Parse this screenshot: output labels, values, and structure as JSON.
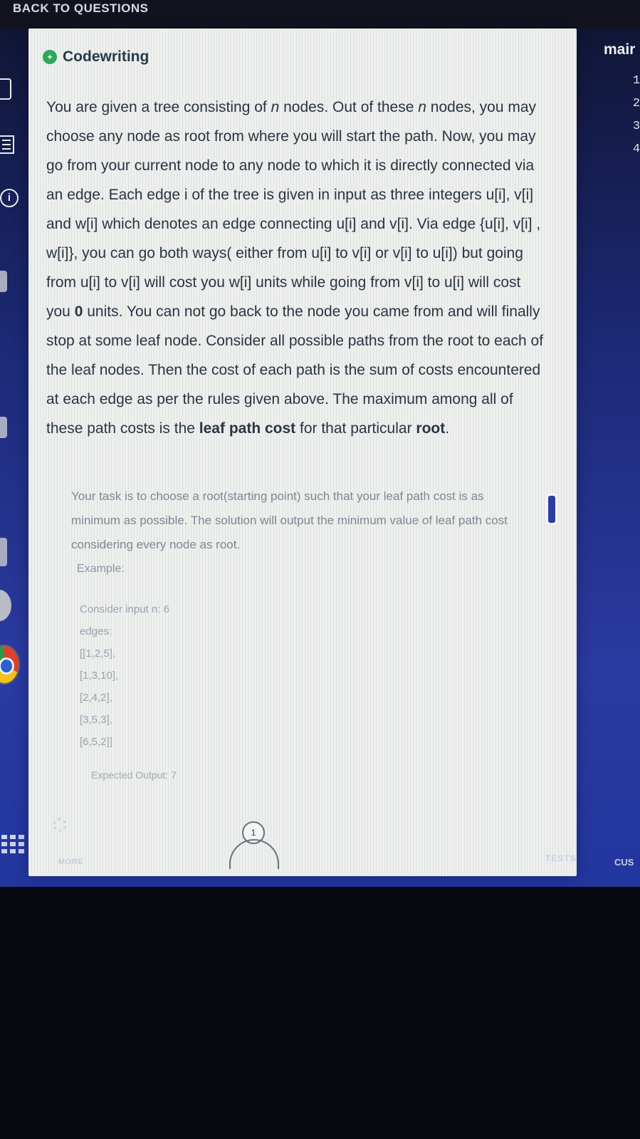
{
  "topbar": {
    "back_label": "BACK TO QUESTIONS"
  },
  "problem": {
    "badge_icon": "codewriting-icon",
    "title": "Codewriting",
    "paragraph_html": "You are given a tree consisting of <i>n</i> nodes. Out of these <i>n</i> nodes, you may choose any node as root from where you will start the path. Now, you may go from your current node to any node to which it is directly connected via an edge. Each edge i of the tree is given in input as three integers u[i], v[i] and w[i] which denotes an edge connecting u[i] and v[i]. Via edge {u[i], v[i] , w[i]}, you can go both ways( either from u[i] to v[i] or v[i] to u[i]) but going from u[i] to v[i] will cost you w[i] units while going from v[i] to u[i] will cost you <b>0</b> units. You can not go back to the node you came from and will finally stop at some leaf node. Consider all possible paths from the root to each of the leaf nodes. Then the cost of each path is the sum of costs encountered at each edge as per the rules given above. The maximum among all of these path costs is the <b>leaf path cost</b> for that particular <b>root</b>.",
    "task": "Your task is to choose a root(starting point) such that your leaf path cost is as minimum as possible. The solution will output the minimum value of leaf path cost considering every node as root.",
    "example_label": "Example:",
    "example_lines": [
      "Consider input n: 6",
      "edges:",
      "[[1,2,5],",
      "[1,3,10],",
      "[2,4,2],",
      "[3,5,3],",
      "[6,5,2]]"
    ],
    "expected_output": "Expected Output: 7"
  },
  "footer": {
    "page_number": "1",
    "more_label": "MORE",
    "tests_label": "TESTS",
    "custom_label": "CUS"
  },
  "editor": {
    "tab_label": "mair",
    "line_numbers": [
      "1",
      "2",
      "3",
      "4"
    ]
  },
  "colors": {
    "panel_bg": "#eef0ed",
    "screen_bg": "#2a3aa0",
    "accent_green": "#2fa858"
  }
}
